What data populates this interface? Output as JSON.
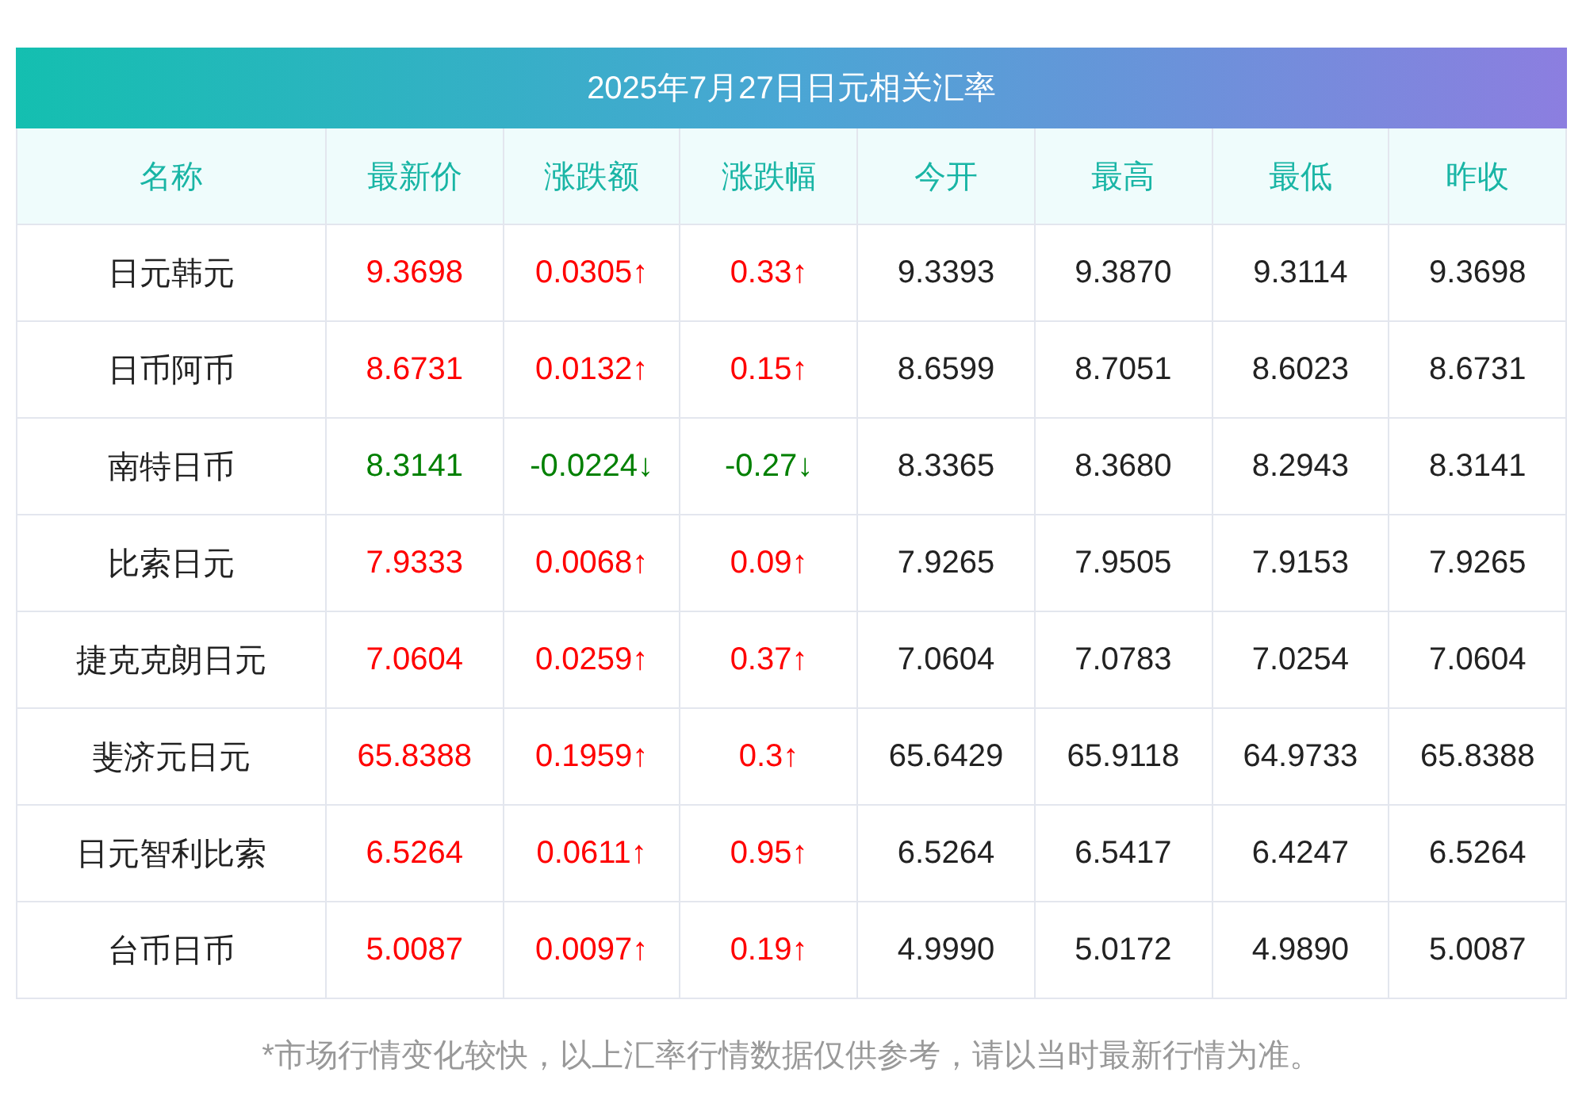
{
  "title": "2025年7月27日日元相关汇率",
  "columns": [
    "名称",
    "最新价",
    "涨跌额",
    "涨跌幅",
    "今开",
    "最高",
    "最低",
    "昨收"
  ],
  "rows": [
    {
      "name": "日元韩元",
      "color": "#ff0000",
      "latest": "9.3698",
      "change": "0.0305↑",
      "pct": "0.33↑",
      "open": "9.3393",
      "high": "9.3870",
      "low": "9.3114",
      "prev": "9.3698"
    },
    {
      "name": "日币阿币",
      "color": "#ff0000",
      "latest": "8.6731",
      "change": "0.0132↑",
      "pct": "0.15↑",
      "open": "8.6599",
      "high": "8.7051",
      "low": "8.6023",
      "prev": "8.6731"
    },
    {
      "name": "南特日币",
      "color": "#008000",
      "latest": "8.3141",
      "change": "-0.0224↓",
      "pct": "-0.27↓",
      "open": "8.3365",
      "high": "8.3680",
      "low": "8.2943",
      "prev": "8.3141"
    },
    {
      "name": "比索日元",
      "color": "#ff0000",
      "latest": "7.9333",
      "change": "0.0068↑",
      "pct": "0.09↑",
      "open": "7.9265",
      "high": "7.9505",
      "low": "7.9153",
      "prev": "7.9265"
    },
    {
      "name": "捷克克朗日元",
      "color": "#ff0000",
      "latest": "7.0604",
      "change": "0.0259↑",
      "pct": "0.37↑",
      "open": "7.0604",
      "high": "7.0783",
      "low": "7.0254",
      "prev": "7.0604"
    },
    {
      "name": "斐济元日元",
      "color": "#ff0000",
      "latest": "65.8388",
      "change": "0.1959↑",
      "pct": "0.3↑",
      "open": "65.6429",
      "high": "65.9118",
      "low": "64.9733",
      "prev": "65.8388"
    },
    {
      "name": "日元智利比索",
      "color": "#ff0000",
      "latest": "6.5264",
      "change": "0.0611↑",
      "pct": "0.95↑",
      "open": "6.5264",
      "high": "6.5417",
      "low": "6.4247",
      "prev": "6.5264"
    },
    {
      "name": "台币日币",
      "color": "#ff0000",
      "latest": "5.0087",
      "change": "0.0097↑",
      "pct": "0.19↑",
      "open": "4.9990",
      "high": "5.0172",
      "low": "4.9890",
      "prev": "5.0087"
    }
  ],
  "footnote": "*市场行情变化较快，以上汇率行情数据仅供参考，请以当时最新行情为准。"
}
